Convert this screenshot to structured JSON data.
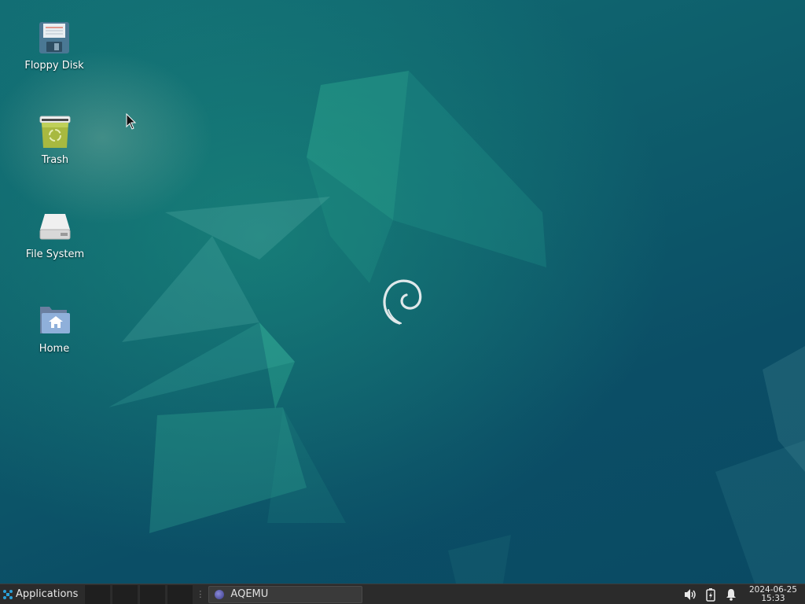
{
  "desktop": {
    "icons": [
      {
        "label": "Floppy Disk",
        "icon": "floppy-disk-icon"
      },
      {
        "label": "Trash",
        "icon": "trash-icon"
      },
      {
        "label": "File System",
        "icon": "drive-icon"
      },
      {
        "label": "Home",
        "icon": "home-folder-icon"
      }
    ],
    "logo": "debian-swirl-logo"
  },
  "taskbar": {
    "applications_label": "Applications",
    "window_buttons": [
      {
        "label": "AQEMU",
        "icon": "aqemu-icon"
      }
    ],
    "tray": {
      "icons": [
        "volume-icon",
        "power-icon",
        "notification-bell-icon"
      ]
    },
    "clock": {
      "date": "2024-06-25",
      "time": "15:33"
    }
  },
  "colors": {
    "desktop_base": "#0c4e63",
    "desktop_accent": "#1a9b83",
    "panel": "#2b2b2b"
  }
}
